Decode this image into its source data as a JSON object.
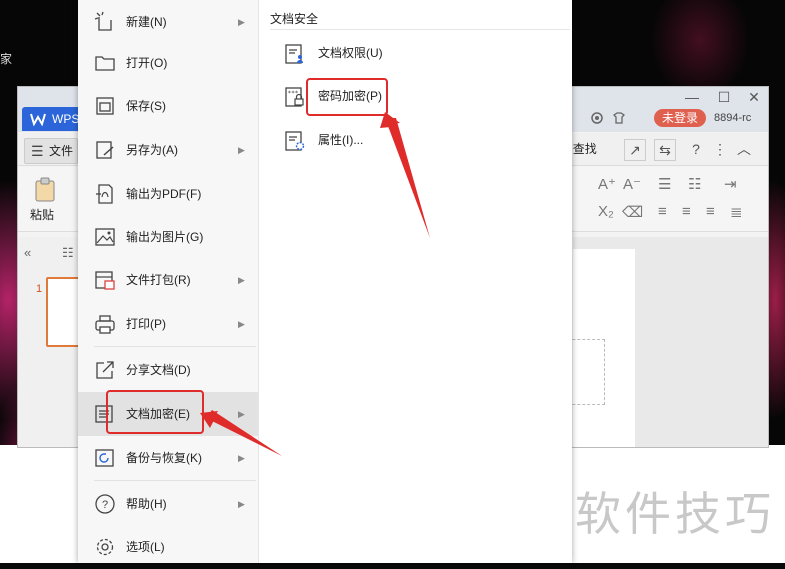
{
  "desktop": {
    "corner_text": "家"
  },
  "window": {
    "app_tab": "WPS",
    "login_label": "未登录",
    "user_id": "8894-rc",
    "file_label": "文件",
    "search_label": "查找",
    "paste_label": "粘贴",
    "slide_number": "1",
    "help_glyph": "?",
    "minimize_glyph": "—",
    "maximize_glyph": "☐",
    "close_glyph": "✕"
  },
  "menu": {
    "items": [
      {
        "label": "新建(N)",
        "icon": "new-file-icon",
        "has_submenu": true
      },
      {
        "label": "打开(O)",
        "icon": "folder-icon",
        "has_submenu": false
      },
      {
        "label": "保存(S)",
        "icon": "save-icon",
        "has_submenu": false
      },
      {
        "label": "另存为(A)",
        "icon": "save-as-icon",
        "has_submenu": true
      },
      {
        "label": "输出为PDF(F)",
        "icon": "pdf-icon",
        "has_submenu": false
      },
      {
        "label": "输出为图片(G)",
        "icon": "image-icon",
        "has_submenu": false
      },
      {
        "label": "文件打包(R)",
        "icon": "package-icon",
        "has_submenu": true
      },
      {
        "label": "打印(P)",
        "icon": "print-icon",
        "has_submenu": true
      },
      {
        "label": "分享文档(D)",
        "icon": "share-icon",
        "has_submenu": false
      },
      {
        "label": "文档加密(E)",
        "icon": "encrypt-doc-icon",
        "has_submenu": true
      },
      {
        "label": "备份与恢复(K)",
        "icon": "backup-icon",
        "has_submenu": true
      },
      {
        "label": "帮助(H)",
        "icon": "help-icon",
        "has_submenu": true
      },
      {
        "label": "选项(L)",
        "icon": "settings-icon",
        "has_submenu": false
      }
    ],
    "active_index": 9
  },
  "submenu": {
    "title": "文档安全",
    "items": [
      {
        "label": "文档权限(U)",
        "icon": "permission-icon"
      },
      {
        "label": "密码加密(P)",
        "icon": "password-lock-icon"
      },
      {
        "label": "属性(I)...",
        "icon": "properties-icon"
      }
    ]
  },
  "watermark": "软件技巧",
  "colors": {
    "accent": "#2b65d9",
    "highlight": "#e02b2b",
    "login": "#e06050",
    "slide_border": "#e07a3a"
  }
}
